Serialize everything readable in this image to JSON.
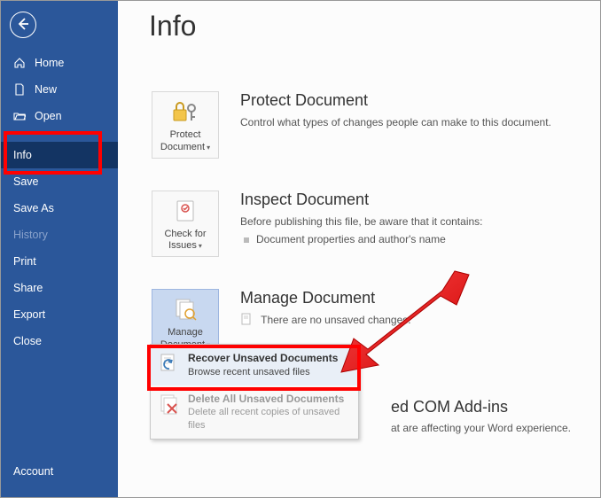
{
  "page_title": "Info",
  "sidebar": {
    "items": [
      {
        "label": "Home"
      },
      {
        "label": "New"
      },
      {
        "label": "Open"
      },
      {
        "label": "Info"
      },
      {
        "label": "Save"
      },
      {
        "label": "Save As"
      },
      {
        "label": "History"
      },
      {
        "label": "Print"
      },
      {
        "label": "Share"
      },
      {
        "label": "Export"
      },
      {
        "label": "Close"
      }
    ],
    "account": "Account"
  },
  "sections": {
    "protect": {
      "tile_line1": "Protect",
      "tile_line2": "Document",
      "heading": "Protect Document",
      "desc": "Control what types of changes people can make to this document."
    },
    "inspect": {
      "tile_line1": "Check for",
      "tile_line2": "Issues",
      "heading": "Inspect Document",
      "desc": "Before publishing this file, be aware that it contains:",
      "bullet1": "Document properties and author's name"
    },
    "manage": {
      "tile_line1": "Manage",
      "tile_line2": "Document",
      "heading": "Manage Document",
      "desc": "There are no unsaved changes."
    },
    "addins": {
      "heading_partial": "ed COM Add-ins",
      "desc_partial": "at are affecting your Word experience."
    }
  },
  "dropdown": {
    "recover": {
      "title": "Recover Unsaved Documents",
      "sub": "Browse recent unsaved files"
    },
    "delete": {
      "title": "Delete All Unsaved Documents",
      "sub": "Delete all recent copies of unsaved files"
    }
  }
}
